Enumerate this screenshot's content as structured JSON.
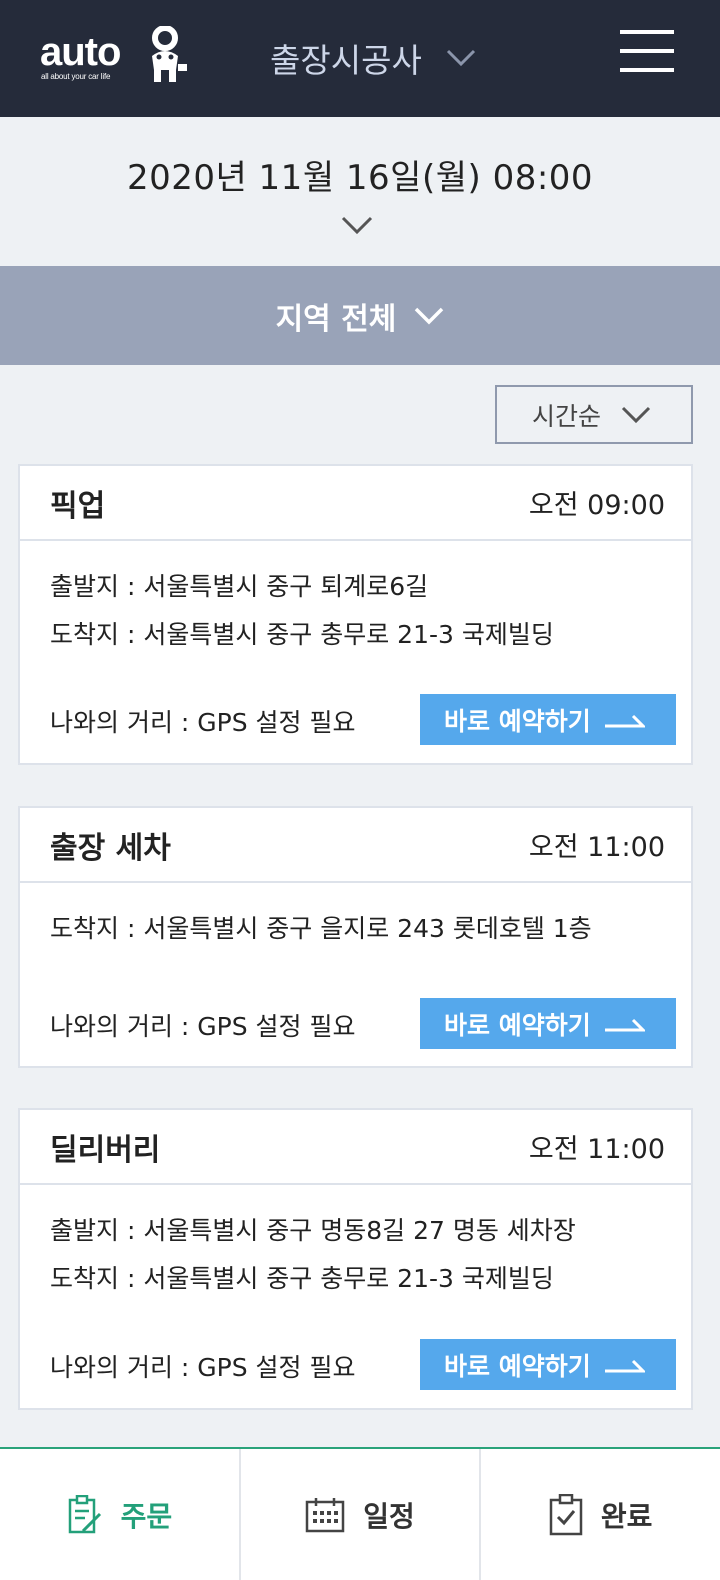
{
  "header": {
    "logo_word": "auto",
    "logo_tagline": "all about your car life",
    "title": "출장시공사",
    "title_icon": "chevron-down-icon",
    "menu_icon": "hamburger-menu-icon"
  },
  "date": {
    "text": "2020년  11월  16일(월)  08:00",
    "icon": "chevron-down-icon"
  },
  "region": {
    "label": "지역 전체",
    "icon": "chevron-down-icon"
  },
  "sort": {
    "selected": "시간순",
    "icon": "chevron-down-icon"
  },
  "cards": [
    {
      "title": "픽업",
      "time": "오전  09:00",
      "lines": [
        "출발지 : 서울특별시 중구 퇴계로6길",
        "도착지 : 서울특별시 중구 충무로 21-3 국제빌딩"
      ],
      "distance": "나와의 거리 : GPS 설정 필요",
      "button": "바로 예약하기"
    },
    {
      "title": "출장 세차",
      "time": "오전  11:00",
      "lines": [
        "도착지 : 서울특별시 중구 을지로 243 롯데호텔 1층"
      ],
      "distance": "나와의 거리 : GPS 설정 필요",
      "button": "바로 예약하기"
    },
    {
      "title": "딜리버리",
      "time": "오전  11:00",
      "lines": [
        "출발지 : 서울특별시 중구 명동8길 27 명동 세차장",
        "도착지 : 서울특별시 중구 충무로 21-3 국제빌딩"
      ],
      "distance": "나와의 거리 : GPS 설정 필요",
      "button": "바로 예약하기"
    }
  ],
  "nav": [
    {
      "label": "주문",
      "icon": "order-clipboard-icon",
      "active": true
    },
    {
      "label": "일정",
      "icon": "calendar-icon",
      "active": false
    },
    {
      "label": "완료",
      "icon": "clipboard-check-icon",
      "active": false
    }
  ],
  "colors": {
    "header_bg": "#252b3a",
    "region_bar": "#99a3b8",
    "button": "#55a8ec",
    "nav_active": "#23a07a"
  }
}
